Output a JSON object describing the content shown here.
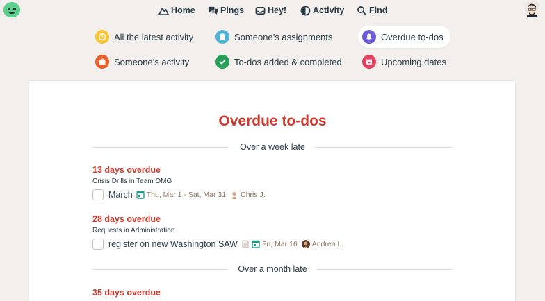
{
  "nav": {
    "home": "Home",
    "pings": "Pings",
    "hey": "Hey!",
    "activity": "Activity",
    "find": "Find"
  },
  "filters": [
    {
      "label": "All the latest activity",
      "color": "#f7c433"
    },
    {
      "label": "Someone’s assignments",
      "color": "#4fb3d9"
    },
    {
      "label": "Overdue to-dos",
      "color": "#6b5bd6",
      "active": true
    },
    {
      "label": "Someone’s activity",
      "color": "#e8602c"
    },
    {
      "label": "To-dos added & completed",
      "color": "#27a05a"
    },
    {
      "label": "Upcoming dates",
      "color": "#e2425d"
    }
  ],
  "page_title": "Overdue to-dos",
  "sections": [
    {
      "heading": "Over a week late",
      "items": [
        {
          "overdue": "13 days overdue",
          "project": "Crisis Drills in Team OMG",
          "title": "March",
          "dates": "Thu, Mar 1 - Sat, Mar 31",
          "assignee": "Chris J."
        },
        {
          "overdue": "28 days overdue",
          "project": "Requests in Administration",
          "title": "register on new Washington SAW",
          "dates": "Fri, Mar 16",
          "assignee": "Andrea L."
        }
      ]
    },
    {
      "heading": "Over a month late",
      "items": [
        {
          "overdue": "35 days overdue"
        }
      ]
    }
  ],
  "colors": {
    "accent_red": "#d03a2d",
    "background": "#f3efec",
    "card": "#ffffff",
    "date_teal": "#1d9a8a"
  }
}
